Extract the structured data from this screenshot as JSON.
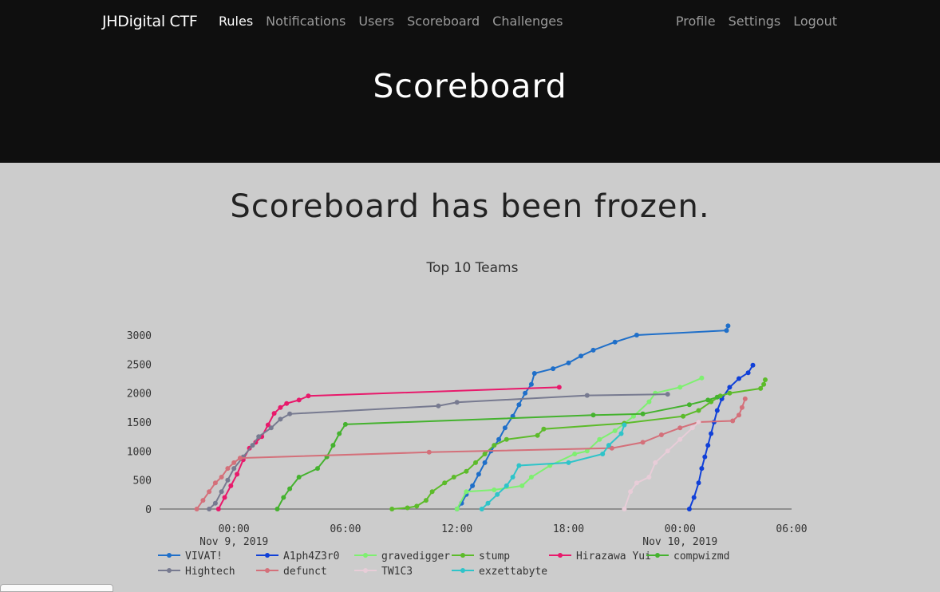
{
  "navbar": {
    "brand": "JHDigital CTF",
    "left_items": [
      "Rules",
      "Notifications",
      "Users",
      "Scoreboard",
      "Challenges"
    ],
    "right_items": [
      "Profile",
      "Settings",
      "Logout"
    ]
  },
  "page_title": "Scoreboard",
  "frozen_message": "Scoreboard has been frozen.",
  "colors": {
    "navbar_bg": "#0f0f0f",
    "page_bg": "#cccccc"
  },
  "chart_data": {
    "type": "line",
    "title": "Top 10 Teams",
    "xlabel": "",
    "ylabel": "",
    "x_range": [
      "2019-11-08 20:00",
      "2019-11-10 06:00"
    ],
    "x_ticks": [
      {
        "time": "2019-11-09 00:00",
        "label": "00:00",
        "sub": "Nov 9, 2019"
      },
      {
        "time": "2019-11-09 06:00",
        "label": "06:00",
        "sub": ""
      },
      {
        "time": "2019-11-09 12:00",
        "label": "12:00",
        "sub": ""
      },
      {
        "time": "2019-11-09 18:00",
        "label": "18:00",
        "sub": ""
      },
      {
        "time": "2019-11-10 00:00",
        "label": "00:00",
        "sub": "Nov 10, 2019"
      },
      {
        "time": "2019-11-10 06:00",
        "label": "06:00",
        "sub": ""
      }
    ],
    "ylim": [
      0,
      3200
    ],
    "y_ticks": [
      0,
      500,
      1000,
      1500,
      2000,
      2500,
      3000
    ],
    "legend_position": "bottom",
    "series": [
      {
        "name": "VIVAT!",
        "color": "#1f6fc9",
        "points": [
          [
            "2019-11-09 12:00",
            0
          ],
          [
            "2019-11-09 12:15",
            100
          ],
          [
            "2019-11-09 12:30",
            250
          ],
          [
            "2019-11-09 12:50",
            400
          ],
          [
            "2019-11-09 13:10",
            600
          ],
          [
            "2019-11-09 13:30",
            800
          ],
          [
            "2019-11-09 13:50",
            1000
          ],
          [
            "2019-11-09 14:15",
            1200
          ],
          [
            "2019-11-09 14:35",
            1400
          ],
          [
            "2019-11-09 15:00",
            1600
          ],
          [
            "2019-11-09 15:20",
            1800
          ],
          [
            "2019-11-09 15:40",
            2000
          ],
          [
            "2019-11-09 16:00",
            2150
          ],
          [
            "2019-11-09 16:10",
            2340
          ],
          [
            "2019-11-09 17:10",
            2420
          ],
          [
            "2019-11-09 18:00",
            2520
          ],
          [
            "2019-11-09 18:40",
            2640
          ],
          [
            "2019-11-09 19:20",
            2740
          ],
          [
            "2019-11-09 20:30",
            2880
          ],
          [
            "2019-11-09 21:40",
            3000
          ],
          [
            "2019-11-10 02:30",
            3080
          ],
          [
            "2019-11-10 02:35",
            3160
          ]
        ]
      },
      {
        "name": "A1ph4Z3r0",
        "color": "#1040d8",
        "points": [
          [
            "2019-11-10 00:30",
            0
          ],
          [
            "2019-11-10 00:45",
            200
          ],
          [
            "2019-11-10 01:00",
            450
          ],
          [
            "2019-11-10 01:10",
            700
          ],
          [
            "2019-11-10 01:20",
            900
          ],
          [
            "2019-11-10 01:30",
            1100
          ],
          [
            "2019-11-10 01:40",
            1300
          ],
          [
            "2019-11-10 01:50",
            1500
          ],
          [
            "2019-11-10 02:00",
            1700
          ],
          [
            "2019-11-10 02:15",
            1900
          ],
          [
            "2019-11-10 02:40",
            2100
          ],
          [
            "2019-11-10 03:10",
            2250
          ],
          [
            "2019-11-10 03:40",
            2350
          ],
          [
            "2019-11-10 03:55",
            2480
          ]
        ]
      },
      {
        "name": "gravedigger",
        "color": "#7ef070",
        "points": [
          [
            "2019-11-09 12:00",
            0
          ],
          [
            "2019-11-09 12:30",
            300
          ],
          [
            "2019-11-09 14:00",
            330
          ],
          [
            "2019-11-09 15:30",
            400
          ],
          [
            "2019-11-09 16:00",
            550
          ],
          [
            "2019-11-09 17:00",
            750
          ],
          [
            "2019-11-09 18:20",
            950
          ],
          [
            "2019-11-09 19:00",
            1000
          ],
          [
            "2019-11-09 19:40",
            1200
          ],
          [
            "2019-11-09 20:30",
            1350
          ],
          [
            "2019-11-09 21:30",
            1600
          ],
          [
            "2019-11-09 22:20",
            1850
          ],
          [
            "2019-11-09 22:40",
            2000
          ],
          [
            "2019-11-10 00:00",
            2100
          ],
          [
            "2019-11-10 01:10",
            2260
          ]
        ]
      },
      {
        "name": "stump",
        "color": "#5cbb2a",
        "points": [
          [
            "2019-11-09 08:30",
            0
          ],
          [
            "2019-11-09 09:20",
            20
          ],
          [
            "2019-11-09 09:50",
            50
          ],
          [
            "2019-11-09 10:20",
            150
          ],
          [
            "2019-11-09 10:40",
            300
          ],
          [
            "2019-11-09 11:20",
            450
          ],
          [
            "2019-11-09 11:50",
            550
          ],
          [
            "2019-11-09 12:30",
            650
          ],
          [
            "2019-11-09 13:00",
            800
          ],
          [
            "2019-11-09 13:30",
            950
          ],
          [
            "2019-11-09 14:00",
            1100
          ],
          [
            "2019-11-09 14:40",
            1200
          ],
          [
            "2019-11-09 16:20",
            1270
          ],
          [
            "2019-11-09 16:40",
            1380
          ],
          [
            "2019-11-09 21:00",
            1480
          ],
          [
            "2019-11-10 00:10",
            1600
          ],
          [
            "2019-11-10 01:00",
            1700
          ],
          [
            "2019-11-10 01:40",
            1850
          ],
          [
            "2019-11-10 02:10",
            1950
          ],
          [
            "2019-11-10 02:40",
            2000
          ],
          [
            "2019-11-10 04:20",
            2080
          ],
          [
            "2019-11-10 04:30",
            2150
          ],
          [
            "2019-11-10 04:35",
            2230
          ]
        ]
      },
      {
        "name": "Hirazawa Yui",
        "color": "#e8196b",
        "points": [
          [
            "2019-11-08 23:10",
            0
          ],
          [
            "2019-11-08 23:30",
            200
          ],
          [
            "2019-11-08 23:50",
            400
          ],
          [
            "2019-11-09 00:10",
            600
          ],
          [
            "2019-11-09 00:30",
            850
          ],
          [
            "2019-11-09 00:50",
            1050
          ],
          [
            "2019-11-09 01:10",
            1150
          ],
          [
            "2019-11-09 01:30",
            1250
          ],
          [
            "2019-11-09 01:50",
            1450
          ],
          [
            "2019-11-09 02:10",
            1650
          ],
          [
            "2019-11-09 02:30",
            1750
          ],
          [
            "2019-11-09 02:50",
            1820
          ],
          [
            "2019-11-09 03:30",
            1880
          ],
          [
            "2019-11-09 04:00",
            1950
          ],
          [
            "2019-11-09 17:30",
            2100
          ]
        ]
      },
      {
        "name": "compwizmd",
        "color": "#44b22e",
        "points": [
          [
            "2019-11-09 02:20",
            0
          ],
          [
            "2019-11-09 02:40",
            200
          ],
          [
            "2019-11-09 03:00",
            350
          ],
          [
            "2019-11-09 03:30",
            550
          ],
          [
            "2019-11-09 04:30",
            700
          ],
          [
            "2019-11-09 05:00",
            900
          ],
          [
            "2019-11-09 05:20",
            1100
          ],
          [
            "2019-11-09 05:40",
            1300
          ],
          [
            "2019-11-09 06:00",
            1460
          ],
          [
            "2019-11-09 19:20",
            1620
          ],
          [
            "2019-11-09 22:00",
            1640
          ],
          [
            "2019-11-10 00:30",
            1800
          ],
          [
            "2019-11-10 01:30",
            1880
          ],
          [
            "2019-11-10 02:00",
            1930
          ]
        ]
      },
      {
        "name": "Hightech",
        "color": "#777a90",
        "points": [
          [
            "2019-11-08 22:40",
            0
          ],
          [
            "2019-11-08 23:00",
            100
          ],
          [
            "2019-11-08 23:20",
            300
          ],
          [
            "2019-11-08 23:40",
            500
          ],
          [
            "2019-11-09 00:00",
            700
          ],
          [
            "2019-11-09 00:30",
            900
          ],
          [
            "2019-11-09 01:00",
            1100
          ],
          [
            "2019-11-09 01:20",
            1250
          ],
          [
            "2019-11-09 02:00",
            1400
          ],
          [
            "2019-11-09 02:30",
            1550
          ],
          [
            "2019-11-09 03:00",
            1640
          ],
          [
            "2019-11-09 11:00",
            1780
          ],
          [
            "2019-11-09 12:00",
            1840
          ],
          [
            "2019-11-09 19:00",
            1960
          ],
          [
            "2019-11-09 23:20",
            1980
          ]
        ]
      },
      {
        "name": "defunct",
        "color": "#d4707a",
        "points": [
          [
            "2019-11-08 22:00",
            0
          ],
          [
            "2019-11-08 22:20",
            150
          ],
          [
            "2019-11-08 22:40",
            300
          ],
          [
            "2019-11-08 23:00",
            450
          ],
          [
            "2019-11-08 23:20",
            550
          ],
          [
            "2019-11-08 23:40",
            700
          ],
          [
            "2019-11-09 00:00",
            800
          ],
          [
            "2019-11-09 00:20",
            880
          ],
          [
            "2019-11-09 10:30",
            980
          ],
          [
            "2019-11-09 20:20",
            1050
          ],
          [
            "2019-11-09 22:00",
            1150
          ],
          [
            "2019-11-09 23:00",
            1280
          ],
          [
            "2019-11-10 00:00",
            1400
          ],
          [
            "2019-11-10 01:00",
            1500
          ],
          [
            "2019-11-10 02:50",
            1520
          ],
          [
            "2019-11-10 03:10",
            1620
          ],
          [
            "2019-11-10 03:20",
            1750
          ],
          [
            "2019-11-10 03:30",
            1900
          ]
        ]
      },
      {
        "name": "TW1C3",
        "color": "#e8cdd8",
        "points": [
          [
            "2019-11-09 21:00",
            0
          ],
          [
            "2019-11-09 21:20",
            300
          ],
          [
            "2019-11-09 21:40",
            450
          ],
          [
            "2019-11-09 22:20",
            550
          ],
          [
            "2019-11-09 22:40",
            800
          ],
          [
            "2019-11-09 23:20",
            1000
          ],
          [
            "2019-11-10 00:00",
            1200
          ],
          [
            "2019-11-10 00:40",
            1400
          ],
          [
            "2019-11-10 01:00",
            1500
          ]
        ]
      },
      {
        "name": "exzettabyte",
        "color": "#2ec4c9",
        "points": [
          [
            "2019-11-09 13:20",
            0
          ],
          [
            "2019-11-09 13:40",
            100
          ],
          [
            "2019-11-09 14:10",
            250
          ],
          [
            "2019-11-09 14:40",
            400
          ],
          [
            "2019-11-09 15:00",
            550
          ],
          [
            "2019-11-09 15:20",
            750
          ],
          [
            "2019-11-09 18:00",
            800
          ],
          [
            "2019-11-09 19:50",
            950
          ],
          [
            "2019-11-09 20:10",
            1100
          ],
          [
            "2019-11-09 20:50",
            1300
          ],
          [
            "2019-11-09 21:00",
            1450
          ]
        ]
      }
    ]
  }
}
